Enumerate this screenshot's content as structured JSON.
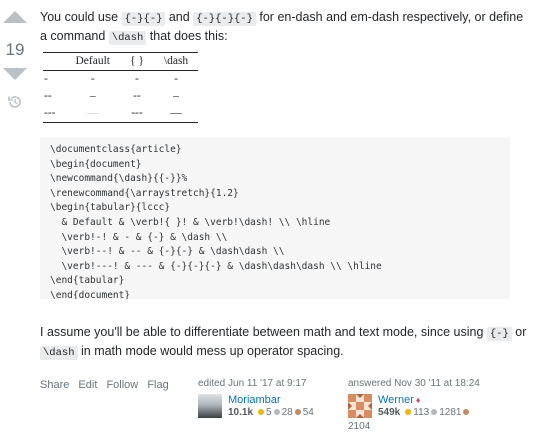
{
  "vote": {
    "count": "19"
  },
  "answer": {
    "intro": {
      "p1": "You could use ",
      "c1": "{-}{-}",
      "p2": " and ",
      "c2": "{-}{-}{-}",
      "p3": " for en-dash and em-dash respectively, or define a command ",
      "c3": "\\dash",
      "p4": " that does this:"
    },
    "table": {
      "headers": [
        "",
        "Default",
        "{ }",
        "\\dash"
      ],
      "rows": [
        [
          "-",
          "-",
          "-",
          "-"
        ],
        [
          "--",
          "–",
          "--",
          "–"
        ],
        [
          "---",
          "—",
          "---",
          "—"
        ]
      ]
    },
    "code_lines": [
      "\\documentclass{article}",
      "\\begin{document}",
      "\\newcommand{\\dash}{{-}}%",
      "\\renewcommand{\\arraystretch}{1.2}",
      "\\begin{tabular}{lccc}",
      "  & Default & \\verb!{ }! & \\verb!\\dash! \\\\ \\hline",
      "  \\verb!-! & - & {-} & \\dash \\\\",
      "  \\verb!--! & -- & {-}{-} & \\dash\\dash \\\\",
      "  \\verb!---! & --- & {-}{-}{-} & \\dash\\dash\\dash \\\\ \\hline",
      "\\end{tabular}",
      "\\end{document}"
    ],
    "outro": {
      "p1": "I assume you'll be able to differentiate between math and text mode, since using ",
      "c1": "{-}",
      "p2": " or ",
      "c2": "\\dash",
      "p3": " in math mode would mess up operator spacing."
    }
  },
  "menu": {
    "share": "Share",
    "edit": "Edit",
    "follow": "Follow",
    "flag": "Flag"
  },
  "editor": {
    "action": "edited Jun 11 '17 at 9:17",
    "name": "Moriambar",
    "rep": "10.1k",
    "gold": "5",
    "silver": "28",
    "bronze": "54"
  },
  "author": {
    "action": "answered Nov 30 '11 at 18:24",
    "name": "Werner",
    "mod_icon": "diamond-icon",
    "rep": "549k",
    "gold": "113",
    "silver": "1281",
    "bronze": "2104"
  },
  "colors": {
    "link": "#0074cc",
    "vote_arrow": "#bbc0c4",
    "code_bg": "#f6f6f6"
  }
}
